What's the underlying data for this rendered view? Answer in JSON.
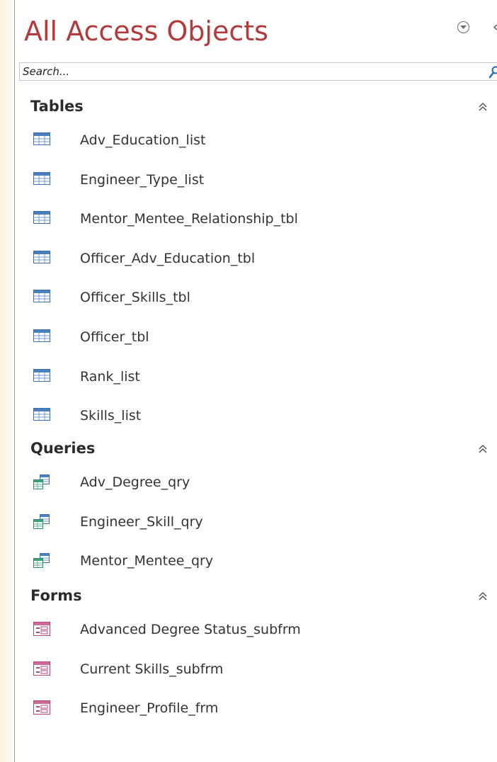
{
  "pane": {
    "title": "All Access Objects",
    "search_placeholder": "Search..."
  },
  "groups": [
    {
      "label": "Tables",
      "icon": "table-icon",
      "items": [
        "Adv_Education_list",
        "Engineer_Type_list",
        "Mentor_Mentee_Relationship_tbl",
        "Officer_Adv_Education_tbl",
        "Officer_Skills_tbl",
        "Officer_tbl",
        "Rank_list",
        "Skills_list"
      ]
    },
    {
      "label": "Queries",
      "icon": "query-icon",
      "items": [
        "Adv_Degree_qry",
        "Engineer_Skill_qry",
        "Mentor_Mentee_qry"
      ]
    },
    {
      "label": "Forms",
      "icon": "form-icon",
      "items": [
        "Advanced Degree Status_subfrm",
        "Current Skills_subfrm",
        "Engineer_Profile_frm"
      ]
    }
  ],
  "colors": {
    "title": "#b23a3a",
    "group_label": "#2b2b2b",
    "item_text": "#333333"
  }
}
